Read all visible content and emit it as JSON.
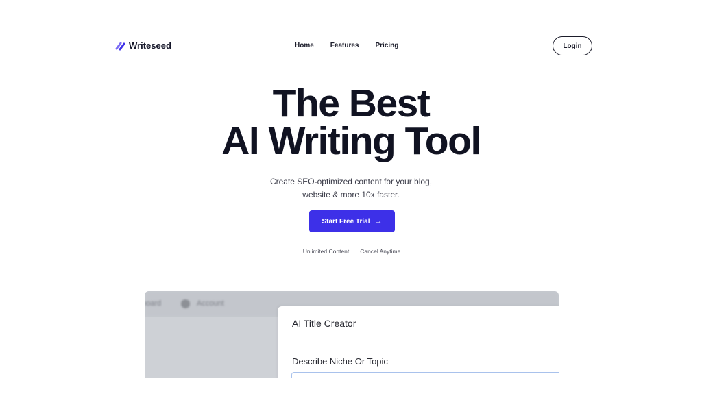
{
  "brand": {
    "name": "Writeseed"
  },
  "nav": {
    "items": [
      {
        "label": "Home"
      },
      {
        "label": "Features"
      },
      {
        "label": "Pricing"
      }
    ],
    "login_label": "Login"
  },
  "hero": {
    "title_line1": "The Best",
    "title_line2": "AI Writing Tool",
    "subtitle_line1": "Create SEO-optimized content for your blog,",
    "subtitle_line2": "website & more 10x faster.",
    "cta_label": "Start Free Trial",
    "cta_icon": "arrow-right-icon",
    "perks": [
      "Unlimited Content",
      "Cancel Anytime"
    ]
  },
  "preview": {
    "topbar_items": [
      "board",
      "Account"
    ],
    "panel_title": "AI Title Creator",
    "field_label": "Describe Niche Or Topic"
  },
  "colors": {
    "accent": "#3d30e8",
    "text": "#111322",
    "logo_mark": "#5b4cf0"
  }
}
